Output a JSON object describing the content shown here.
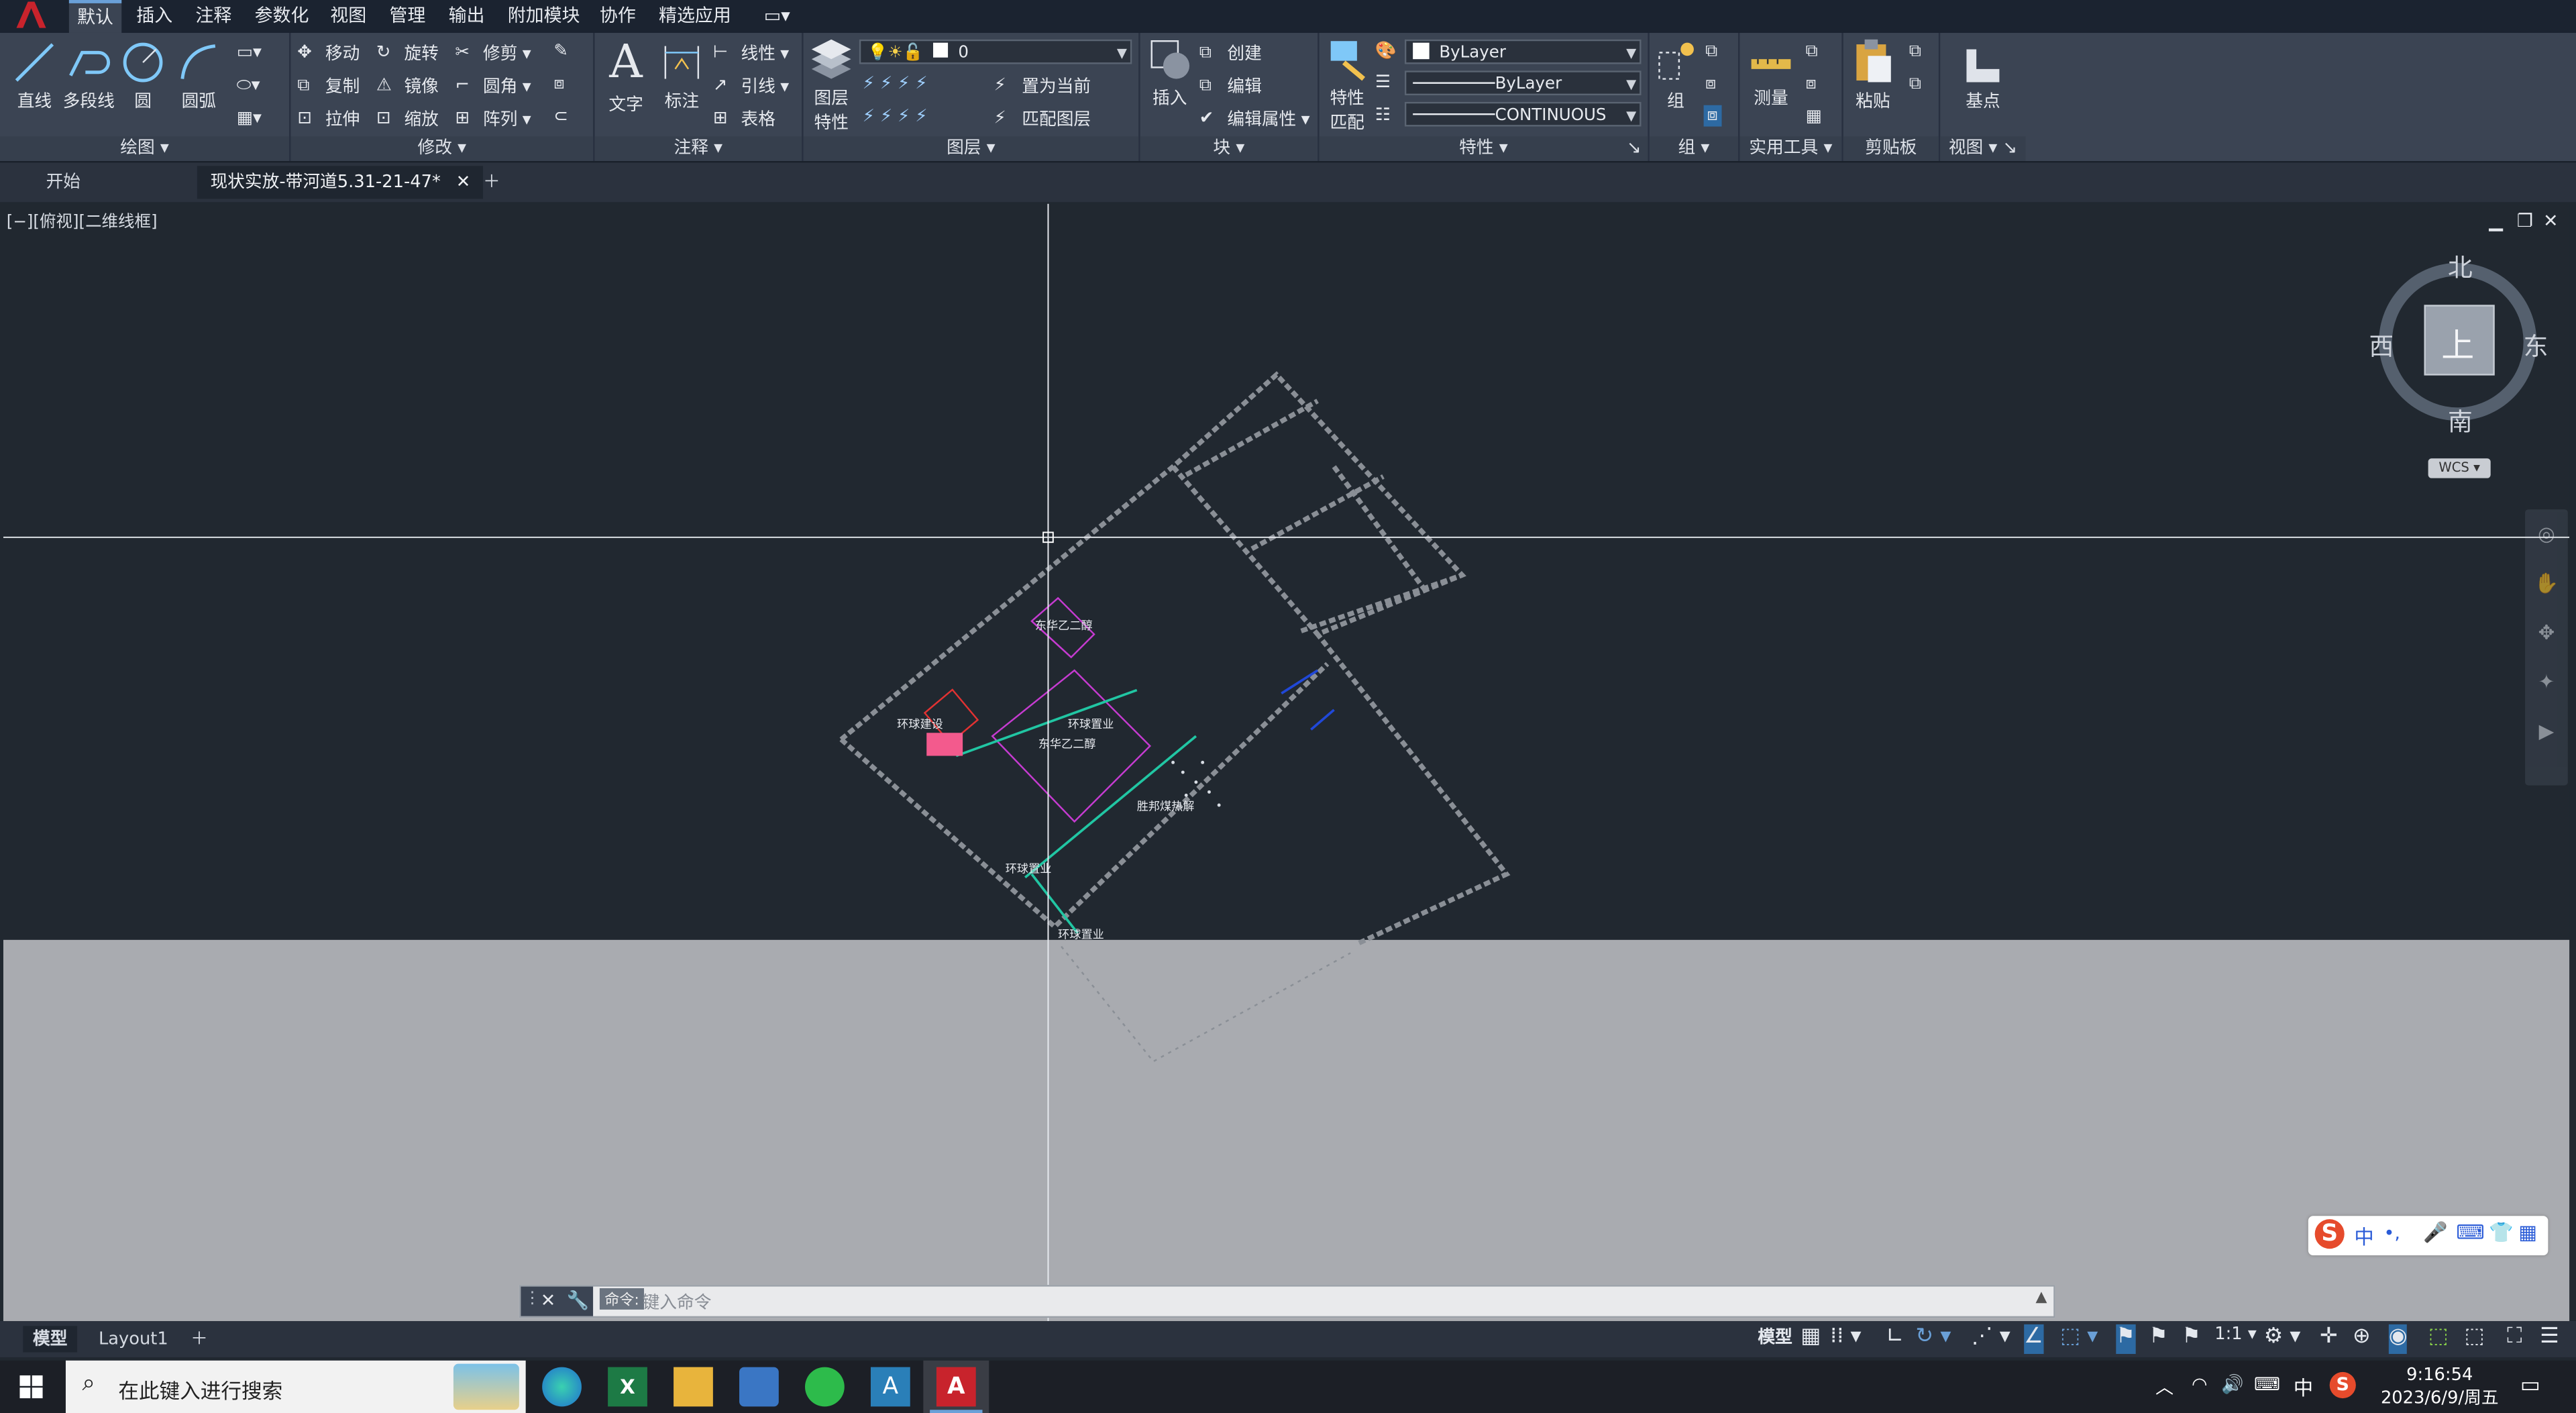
{
  "menu": [
    "默认",
    "插入",
    "注释",
    "参数化",
    "视图",
    "管理",
    "输出",
    "附加模块",
    "协作",
    "精选应用"
  ],
  "ribbon": {
    "draw": {
      "title": "绘图",
      "line": "直线",
      "polyline": "多段线",
      "circle": "圆",
      "arc": "圆弧"
    },
    "modify": {
      "title": "修改",
      "move": "移动",
      "rotate": "旋转",
      "trim": "修剪",
      "copy": "复制",
      "mirror": "镜像",
      "fillet": "圆角",
      "stretch": "拉伸",
      "scale": "缩放",
      "array": "阵列"
    },
    "annotation": {
      "title": "注释",
      "text": "文字",
      "dimension": "标注",
      "linear": "线性",
      "leader": "引线",
      "table": "表格"
    },
    "layers": {
      "title": "图层",
      "layer_props_1": "图层",
      "layer_props_2": "特性",
      "current_layer": "0",
      "set_current": "置为当前",
      "match_layer": "匹配图层"
    },
    "block": {
      "title": "块",
      "insert": "插入",
      "create": "创建",
      "edit": "编辑",
      "edit_attr": "编辑属性"
    },
    "properties": {
      "title": "特性",
      "match_1": "特性",
      "match_2": "匹配",
      "color": "ByLayer",
      "lineweight": "ByLayer",
      "linetype": "CONTINUOUS"
    },
    "groups": {
      "title": "组",
      "group": "组"
    },
    "utilities": {
      "title": "实用工具",
      "measure": "测量"
    },
    "clipboard": {
      "title": "剪贴板",
      "paste": "粘贴"
    },
    "view": {
      "title": "视图",
      "basepoint": "基点"
    }
  },
  "tabs": {
    "start": "开始",
    "file": "现状实放-带河道5.31-21-47*"
  },
  "viewport": {
    "label": "[−][俯视][二维线框]",
    "viewcube": {
      "north": "北",
      "south": "南",
      "west": "西",
      "east": "东",
      "top": "上",
      "wcs": "WCS"
    },
    "drawing_labels": [
      "东华乙二醇",
      "环球置业",
      "东华乙二醇",
      "环球建设",
      "胜邦煤热解",
      "环球置业",
      "环球置业"
    ]
  },
  "command": {
    "placeholder": "键入命令",
    "tip": "命令:"
  },
  "layouts": {
    "model": "模型",
    "layout1": "Layout1"
  },
  "status": {
    "model": "模型",
    "scale": "1:1"
  },
  "taskbar": {
    "search_placeholder": "在此键入进行搜索",
    "ime": "中",
    "time": "9:16:54",
    "date": "2023/6/9/周五"
  }
}
